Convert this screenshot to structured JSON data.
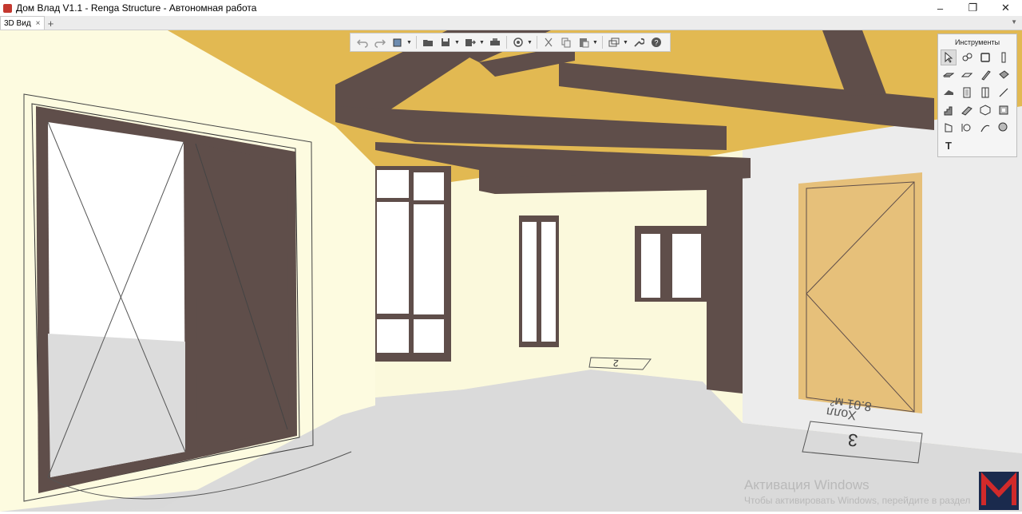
{
  "window": {
    "title": "Дом Влад V1.1 - Renga Structure - Автономная работа",
    "controls": {
      "minimize": "–",
      "restore": "❐",
      "close": "✕"
    }
  },
  "tabs": [
    {
      "label": "3D Вид",
      "close": "×",
      "active": true
    }
  ],
  "tab_add": "+",
  "tab_menu": "▼",
  "toolbar": {
    "buttons": [
      "undo-icon",
      "redo-icon",
      "view-cube-icon",
      "open-folder-icon",
      "save-icon",
      "export-icon",
      "print-icon",
      "orbit-icon",
      "cut-icon",
      "copy-icon",
      "paste-icon",
      "layers-icon",
      "wrench-icon",
      "help-icon"
    ]
  },
  "tools_panel": {
    "title": "Инструменты",
    "tools": [
      "select-icon",
      "dimension-icon",
      "wall-icon",
      "column-icon",
      "floor-slab-icon",
      "plate-icon",
      "beam-icon",
      "rebar-icon",
      "roof-icon",
      "door-icon",
      "window-icon",
      "line-icon",
      "stair-icon",
      "ramp-icon",
      "element-icon",
      "opening-icon",
      "railing-icon",
      "axis-icon",
      "curve-icon",
      "fill-icon",
      "text-icon"
    ],
    "text_tool_label": "T"
  },
  "scene": {
    "room_labels": [
      {
        "number": "3",
        "name": "Холл",
        "area": "8.01 м²"
      },
      {
        "number": "2",
        "name": "",
        "area": ""
      }
    ],
    "colors": {
      "wall": "#fdfbe0",
      "floor": "#d8d8d8",
      "ceiling": "#e2b952",
      "beam": "#5f4e4a",
      "door_leaf": "#e6c07a",
      "frame": "#5f4e4a"
    }
  },
  "watermark": {
    "title": "Активация Windows",
    "subtitle": "Чтобы активировать Windows, перейдите в раздел"
  }
}
